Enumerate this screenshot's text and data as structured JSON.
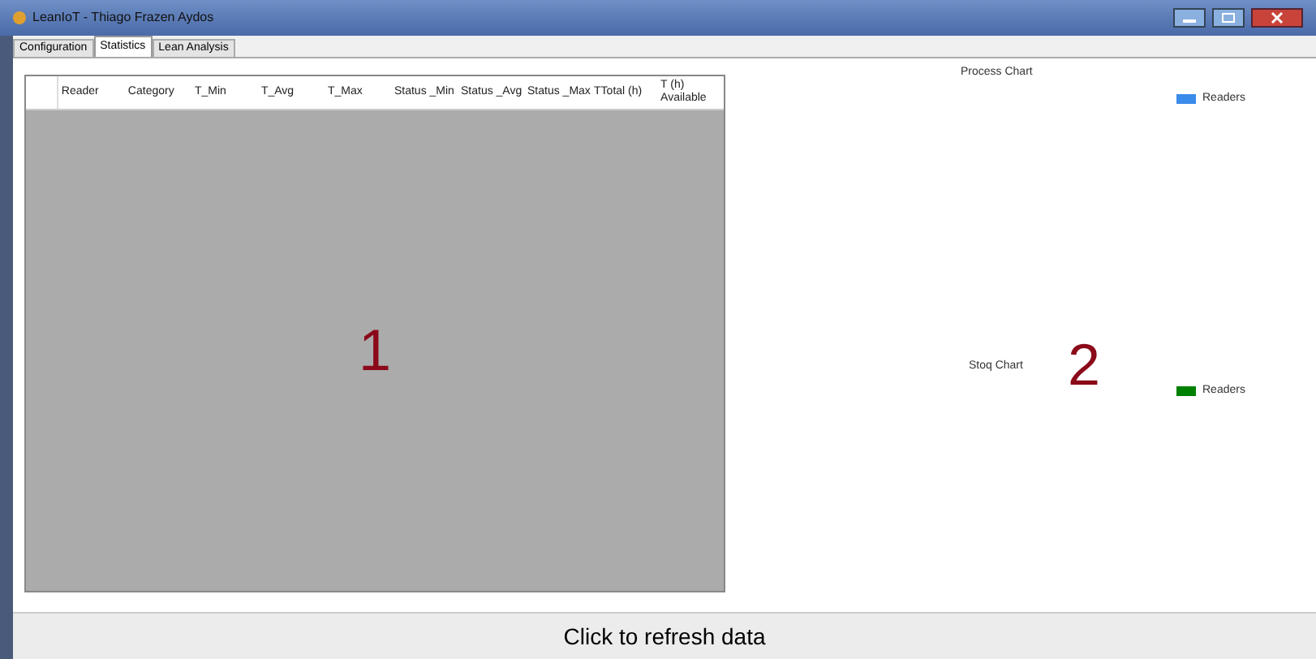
{
  "window": {
    "title": "LeanIoT - Thiago Frazen Aydos"
  },
  "tabs": [
    {
      "label": "Configuration",
      "selected": false
    },
    {
      "label": "Statistics",
      "selected": true
    },
    {
      "label": "Lean Analysis",
      "selected": false
    }
  ],
  "table": {
    "columns": [
      "Reader",
      "Category",
      "T_Min",
      "T_Avg",
      "T_Max",
      "Status _Min",
      "Status _Avg",
      "Status _Max",
      "TTotal (h)",
      "T (h) Available"
    ]
  },
  "annotations": [
    "1",
    "2"
  ],
  "charts": [
    {
      "title": "Process Chart",
      "legend": "Readers",
      "color": "#3b8beb"
    },
    {
      "title": "Stoq Chart",
      "legend": "Readers",
      "color": "#008000"
    }
  ],
  "refresh_button": "Click to refresh data"
}
